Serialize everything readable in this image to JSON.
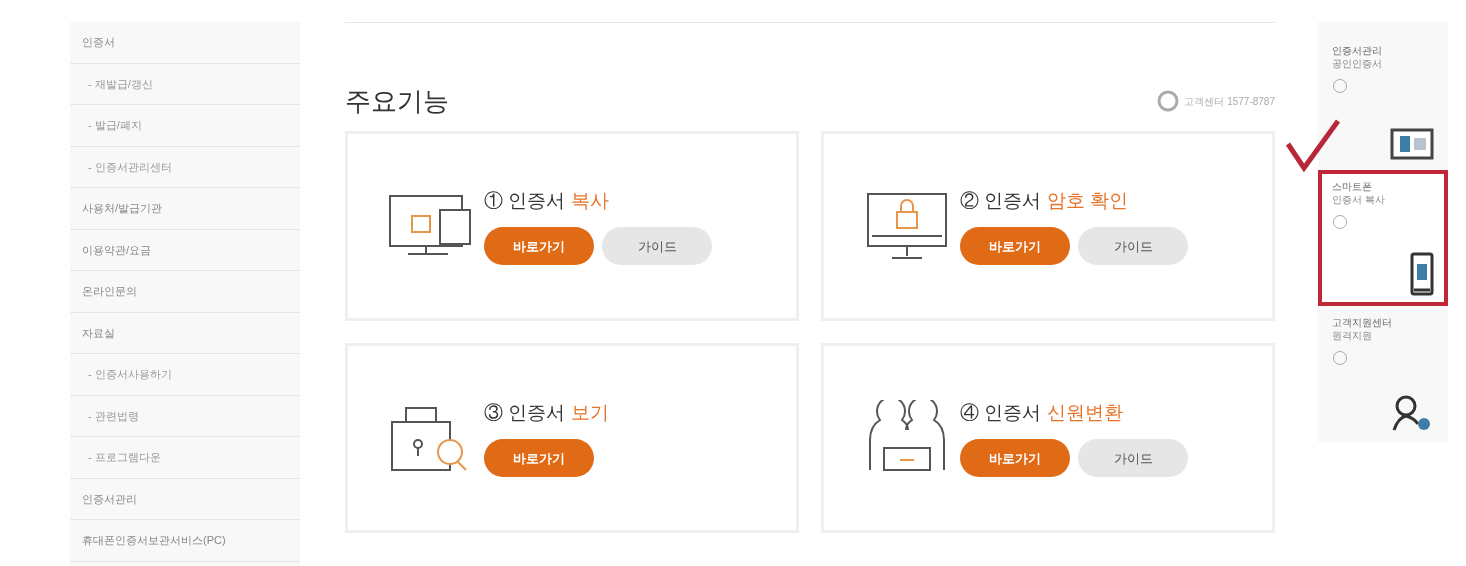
{
  "sidebar": {
    "items": [
      {
        "label": "인증서",
        "sub": false
      },
      {
        "label": "- 재발급/갱신",
        "sub": true
      },
      {
        "label": "- 발급/폐지",
        "sub": true
      },
      {
        "label": "- 인증서관리센터",
        "sub": true
      },
      {
        "label": "사용처/발급기관",
        "sub": false
      },
      {
        "label": "이용약관/요금",
        "sub": false
      },
      {
        "label": "온라인문의",
        "sub": false
      },
      {
        "label": "자료실",
        "sub": false
      },
      {
        "label": "- 인증서사용하기",
        "sub": true
      },
      {
        "label": "- 관련법령",
        "sub": true
      },
      {
        "label": "- 프로그램다운",
        "sub": true
      },
      {
        "label": "인증서관리",
        "sub": false
      },
      {
        "label": "휴대폰인증서보관서비스(PC)",
        "sub": false
      }
    ]
  },
  "main": {
    "title": "주요기능",
    "help": "고객센터 1577-8787",
    "cards": [
      {
        "kind": "copy",
        "number": "①",
        "prefix": "인증서",
        "accent": "복사",
        "go": "바로가기",
        "guide": "가이드"
      },
      {
        "kind": "password",
        "number": "②",
        "prefix": "인증서",
        "accent": "암호 확인",
        "go": "바로가기",
        "guide": "가이드"
      },
      {
        "kind": "view",
        "number": "③",
        "prefix": "인증서",
        "accent": "보기",
        "go": "바로가기"
      },
      {
        "kind": "convert",
        "number": "④",
        "prefix": "인증서",
        "accent": "신원변환",
        "go": "바로가기",
        "guide": "가이드"
      }
    ]
  },
  "quick": {
    "items": [
      {
        "kind": "manager",
        "line1": "인증서관리",
        "line2": "공인인증서",
        "highlighted": false
      },
      {
        "kind": "phone",
        "line1": "스마트폰",
        "line2": "인증서 복사",
        "highlighted": true
      },
      {
        "kind": "support",
        "line1": "고객지원센터",
        "line2": "원격지원",
        "highlighted": false
      }
    ]
  }
}
